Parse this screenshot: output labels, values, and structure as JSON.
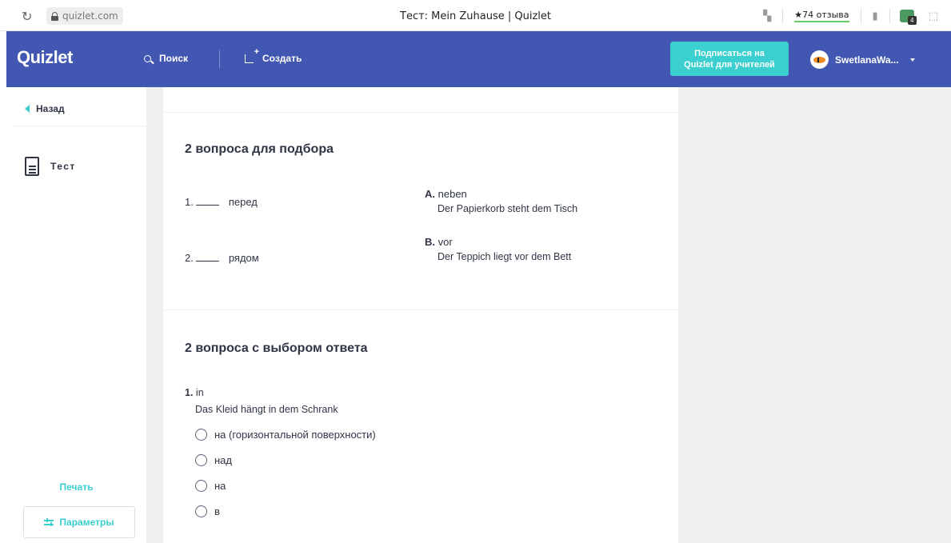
{
  "browser": {
    "url": "quizlet.com",
    "title": "Тест: Mein Zuhause | Quizlet",
    "reviews_label": "★74 отзыва"
  },
  "header": {
    "logo": "Quizlet",
    "search_label": "Поиск",
    "create_label": "Создать",
    "subscribe_line1": "Подписаться на",
    "subscribe_line2": "Quizlet для учителей",
    "username": "SwetlanaWa..."
  },
  "sidebar": {
    "back_label": "Назад",
    "test_label": "Тест",
    "print_label": "Печать",
    "params_label": "Параметры"
  },
  "matching": {
    "title": "2 вопроса для подбора",
    "questions": [
      {
        "num": "1.",
        "text": "перед"
      },
      {
        "num": "2.",
        "text": "рядом"
      }
    ],
    "answers": [
      {
        "letter": "A.",
        "term": "neben",
        "example": "Der Papierkorb steht dem Tisch"
      },
      {
        "letter": "B.",
        "term": "vor",
        "example": "Der Teppich liegt vor dem Bett"
      }
    ]
  },
  "multiple_choice": {
    "title": "2 вопроса с выбором ответа",
    "question": {
      "num": "1.",
      "term": "in",
      "example": "Das Kleid hängt in dem Schrank"
    },
    "options": [
      "на (горизонтальной поверхности)",
      "над",
      "на",
      "в"
    ]
  }
}
